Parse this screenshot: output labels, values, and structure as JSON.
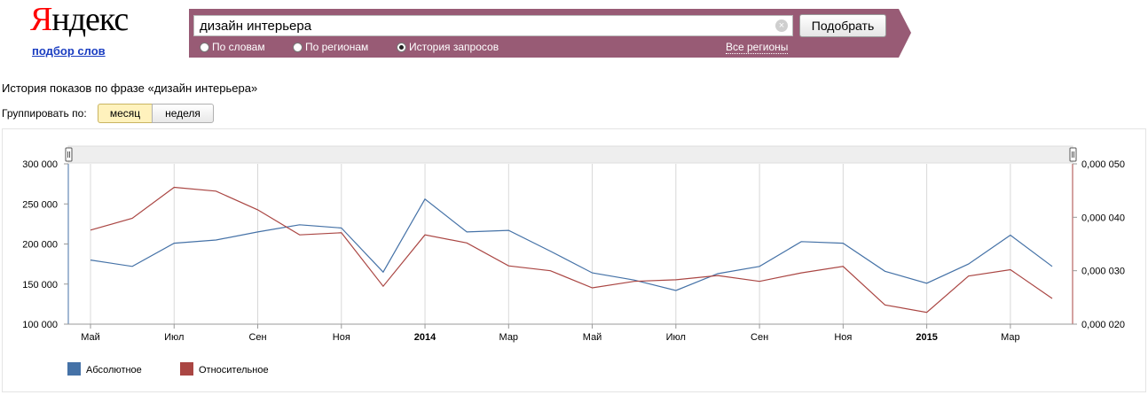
{
  "logo": {
    "first_letter": "Я",
    "rest": "ндекс",
    "subtitle": "подбор слов"
  },
  "search": {
    "query": "дизайн интерьера",
    "clear_glyph": "×",
    "submit_label": "Подобрать"
  },
  "modes": [
    {
      "label": "По словам",
      "checked": false
    },
    {
      "label": "По регионам",
      "checked": false
    },
    {
      "label": "История запросов",
      "checked": true
    }
  ],
  "regions_link": "Все регионы",
  "heading": "История показов по фразе «дизайн интерьера»",
  "grouping": {
    "label": "Группировать по:",
    "month": "месяц",
    "week": "неделя",
    "selected": "месяц"
  },
  "colors": {
    "absolute": "#4572a7",
    "relative": "#aa4643",
    "bar": "#985b75"
  },
  "chart_data": {
    "type": "line",
    "x": [
      "2013-05",
      "2013-06",
      "2013-07",
      "2013-08",
      "2013-09",
      "2013-10",
      "2013-11",
      "2013-12",
      "2014-01",
      "2014-02",
      "2014-03",
      "2014-04",
      "2014-05",
      "2014-06",
      "2014-07",
      "2014-08",
      "2014-09",
      "2014-10",
      "2014-11",
      "2014-12",
      "2015-01",
      "2015-02",
      "2015-03",
      "2015-04"
    ],
    "x_ticks": [
      {
        "label": "Май",
        "x": "2013-05",
        "bold": false
      },
      {
        "label": "Июл",
        "x": "2013-07",
        "bold": false
      },
      {
        "label": "Сен",
        "x": "2013-09",
        "bold": false
      },
      {
        "label": "Ноя",
        "x": "2013-11",
        "bold": false
      },
      {
        "label": "2014",
        "x": "2014-01",
        "bold": true
      },
      {
        "label": "Мар",
        "x": "2014-03",
        "bold": false
      },
      {
        "label": "Май",
        "x": "2014-05",
        "bold": false
      },
      {
        "label": "Июл",
        "x": "2014-07",
        "bold": false
      },
      {
        "label": "Сен",
        "x": "2014-09",
        "bold": false
      },
      {
        "label": "Ноя",
        "x": "2014-11",
        "bold": false
      },
      {
        "label": "2015",
        "x": "2015-01",
        "bold": true
      },
      {
        "label": "Мар",
        "x": "2015-03",
        "bold": false
      }
    ],
    "series": [
      {
        "name": "Абсолютное",
        "axis": "left",
        "color": "#4572a7",
        "values": [
          180000,
          172000,
          201000,
          205000,
          215000,
          224000,
          220000,
          165000,
          256000,
          215000,
          217000,
          191000,
          164000,
          155000,
          142000,
          163000,
          172000,
          203000,
          201000,
          166000,
          151000,
          175000,
          211000,
          172000
        ]
      },
      {
        "name": "Относительное",
        "axis": "right",
        "color": "#aa4643",
        "values": [
          0.0376,
          0.0398,
          0.0456,
          0.0449,
          0.0414,
          0.0367,
          0.0371,
          0.0271,
          0.0367,
          0.0352,
          0.0309,
          0.03,
          0.0268,
          0.028,
          0.0283,
          0.0291,
          0.028,
          0.0296,
          0.0308,
          0.0236,
          0.0222,
          0.029,
          0.0302,
          0.0248
        ]
      }
    ],
    "y_left": {
      "ticks": [
        "300 000",
        "250 000",
        "200 000",
        "150 000",
        "100 000"
      ],
      "values": [
        300000,
        250000,
        200000,
        150000,
        100000
      ],
      "range": [
        100000,
        300000
      ]
    },
    "y_right": {
      "ticks": [
        "0,000 050",
        "0,000 040",
        "0,000 030",
        "0,000 020"
      ],
      "values": [
        0.05,
        0.04,
        0.03,
        0.02
      ],
      "range": [
        0.02,
        0.05
      ]
    },
    "grid": "vertical",
    "legend_position": "bottom-left"
  }
}
